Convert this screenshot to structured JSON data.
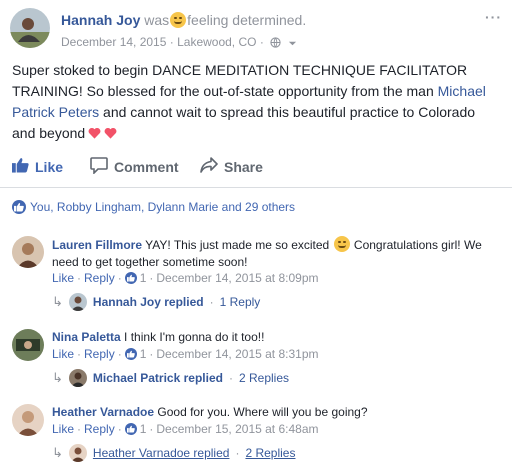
{
  "post": {
    "author": "Hannah Joy",
    "was_text": "was",
    "feeling_text": "feeling determined.",
    "date": "December 14, 2015",
    "location": "Lakewood, CO",
    "separator": "·",
    "more_label": "···",
    "body_line1": "Super stoked to begin DANCE MEDITATION TECHNIQUE FACILITATOR TRAINING! So blessed for the out-of-state opportunity from the man",
    "body_link": "Michael Patrick Peters",
    "body_line2": "and cannot wait to spread this beautiful practice to Colorado and beyond"
  },
  "actions": {
    "like": "Like",
    "comment": "Comment",
    "share": "Share"
  },
  "reactions": {
    "text": "You, Robby Lingham, Dylann Marie and 29 others"
  },
  "comments": [
    {
      "author": "Lauren Fillmore",
      "text_before": "YAY! This just made me so excited",
      "text_after": "Congratulations girl! We need to get together sometime soon!",
      "like": "Like",
      "reply": "Reply",
      "like_count": "1",
      "date": "December 14, 2015 at 8:09pm",
      "reply_author": "Hannah Joy replied",
      "reply_count": "1 Reply"
    },
    {
      "author": "Nina Paletta",
      "text_before": "I think I'm gonna do it too!!",
      "text_after": "",
      "like": "Like",
      "reply": "Reply",
      "like_count": "1",
      "date": "December 14, 2015 at 8:31pm",
      "reply_author": "Michael Patrick replied",
      "reply_count": "2 Replies"
    },
    {
      "author": "Heather Varnadoe",
      "text_before": "Good for you. Where will you be going?",
      "text_after": "",
      "like": "Like",
      "reply": "Reply",
      "like_count": "1",
      "date": "December 15, 2015 at 6:48am",
      "reply_author": "Heather Varnadoe replied",
      "reply_count": "2 Replies"
    }
  ],
  "colors": {
    "link_blue": "#365899",
    "like_blue": "#4267b2",
    "muted_gray": "#90949c",
    "heart_red": "#f25268"
  },
  "icons": [
    "feeling-emoji-icon",
    "globe-icon",
    "chevron-down-icon",
    "more-icon",
    "thumbs-up-icon",
    "comment-icon",
    "share-icon",
    "heart-icon",
    "reply-arrow-icon"
  ]
}
